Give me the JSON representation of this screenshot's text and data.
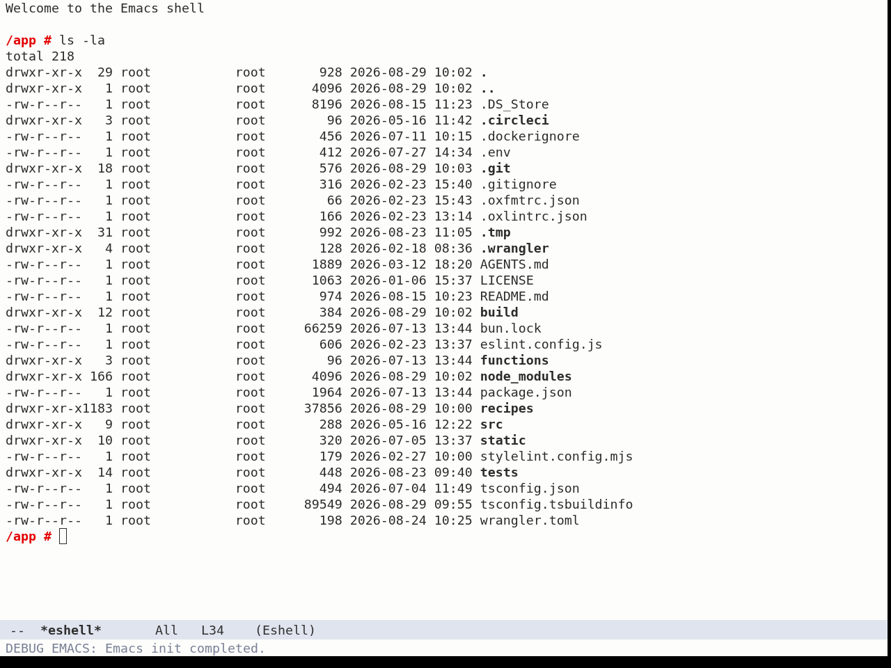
{
  "shell": {
    "banner": "Welcome to the Emacs shell",
    "command": {
      "prompt": "/app #",
      "input": "ls -la"
    },
    "total": "total 218",
    "entries": [
      {
        "kind": "directory",
        "permissions": "drwxr-xr-x",
        "links": "29",
        "owner": "root",
        "group": "root",
        "size": "928",
        "date": "2026-08-29",
        "time": "10:02",
        "name": "."
      },
      {
        "kind": "directory",
        "permissions": "drwxr-xr-x",
        "links": "1",
        "owner": "root",
        "group": "root",
        "size": "4096",
        "date": "2026-08-29",
        "time": "10:02",
        "name": ".."
      },
      {
        "kind": "file",
        "permissions": "-rw-r--r--",
        "links": "1",
        "owner": "root",
        "group": "root",
        "size": "8196",
        "date": "2026-08-15",
        "time": "11:23",
        "name": ".DS_Store"
      },
      {
        "kind": "directory",
        "permissions": "drwxr-xr-x",
        "links": "3",
        "owner": "root",
        "group": "root",
        "size": "96",
        "date": "2026-05-16",
        "time": "11:42",
        "name": ".circleci"
      },
      {
        "kind": "file",
        "permissions": "-rw-r--r--",
        "links": "1",
        "owner": "root",
        "group": "root",
        "size": "456",
        "date": "2026-07-11",
        "time": "10:15",
        "name": ".dockerignore"
      },
      {
        "kind": "file",
        "permissions": "-rw-r--r--",
        "links": "1",
        "owner": "root",
        "group": "root",
        "size": "412",
        "date": "2026-07-27",
        "time": "14:34",
        "name": ".env"
      },
      {
        "kind": "directory",
        "permissions": "drwxr-xr-x",
        "links": "18",
        "owner": "root",
        "group": "root",
        "size": "576",
        "date": "2026-08-29",
        "time": "10:03",
        "name": ".git"
      },
      {
        "kind": "file",
        "permissions": "-rw-r--r--",
        "links": "1",
        "owner": "root",
        "group": "root",
        "size": "316",
        "date": "2026-02-23",
        "time": "15:40",
        "name": ".gitignore"
      },
      {
        "kind": "file",
        "permissions": "-rw-r--r--",
        "links": "1",
        "owner": "root",
        "group": "root",
        "size": "66",
        "date": "2026-02-23",
        "time": "15:43",
        "name": ".oxfmtrc.json"
      },
      {
        "kind": "file",
        "permissions": "-rw-r--r--",
        "links": "1",
        "owner": "root",
        "group": "root",
        "size": "166",
        "date": "2026-02-23",
        "time": "13:14",
        "name": ".oxlintrc.json"
      },
      {
        "kind": "directory",
        "permissions": "drwxr-xr-x",
        "links": "31",
        "owner": "root",
        "group": "root",
        "size": "992",
        "date": "2026-08-23",
        "time": "11:05",
        "name": ".tmp"
      },
      {
        "kind": "directory",
        "permissions": "drwxr-xr-x",
        "links": "4",
        "owner": "root",
        "group": "root",
        "size": "128",
        "date": "2026-02-18",
        "time": "08:36",
        "name": ".wrangler"
      },
      {
        "kind": "file",
        "permissions": "-rw-r--r--",
        "links": "1",
        "owner": "root",
        "group": "root",
        "size": "1889",
        "date": "2026-03-12",
        "time": "18:20",
        "name": "AGENTS.md"
      },
      {
        "kind": "file",
        "permissions": "-rw-r--r--",
        "links": "1",
        "owner": "root",
        "group": "root",
        "size": "1063",
        "date": "2026-01-06",
        "time": "15:37",
        "name": "LICENSE"
      },
      {
        "kind": "file",
        "permissions": "-rw-r--r--",
        "links": "1",
        "owner": "root",
        "group": "root",
        "size": "974",
        "date": "2026-08-15",
        "time": "10:23",
        "name": "README.md"
      },
      {
        "kind": "directory",
        "permissions": "drwxr-xr-x",
        "links": "12",
        "owner": "root",
        "group": "root",
        "size": "384",
        "date": "2026-08-29",
        "time": "10:02",
        "name": "build"
      },
      {
        "kind": "file",
        "permissions": "-rw-r--r--",
        "links": "1",
        "owner": "root",
        "group": "root",
        "size": "66259",
        "date": "2026-07-13",
        "time": "13:44",
        "name": "bun.lock"
      },
      {
        "kind": "file",
        "permissions": "-rw-r--r--",
        "links": "1",
        "owner": "root",
        "group": "root",
        "size": "606",
        "date": "2026-02-23",
        "time": "13:37",
        "name": "eslint.config.js"
      },
      {
        "kind": "directory",
        "permissions": "drwxr-xr-x",
        "links": "3",
        "owner": "root",
        "group": "root",
        "size": "96",
        "date": "2026-07-13",
        "time": "13:44",
        "name": "functions"
      },
      {
        "kind": "directory",
        "permissions": "drwxr-xr-x",
        "links": "166",
        "owner": "root",
        "group": "root",
        "size": "4096",
        "date": "2026-08-29",
        "time": "10:02",
        "name": "node_modules"
      },
      {
        "kind": "file",
        "permissions": "-rw-r--r--",
        "links": "1",
        "owner": "root",
        "group": "root",
        "size": "1964",
        "date": "2026-07-13",
        "time": "13:44",
        "name": "package.json"
      },
      {
        "kind": "directory",
        "permissions": "drwxr-xr-x",
        "links": "1183",
        "owner": "root",
        "group": "root",
        "size": "37856",
        "date": "2026-08-29",
        "time": "10:00",
        "name": "recipes"
      },
      {
        "kind": "directory",
        "permissions": "drwxr-xr-x",
        "links": "9",
        "owner": "root",
        "group": "root",
        "size": "288",
        "date": "2026-05-16",
        "time": "12:22",
        "name": "src"
      },
      {
        "kind": "directory",
        "permissions": "drwxr-xr-x",
        "links": "10",
        "owner": "root",
        "group": "root",
        "size": "320",
        "date": "2026-07-05",
        "time": "13:37",
        "name": "static"
      },
      {
        "kind": "file",
        "permissions": "-rw-r--r--",
        "links": "1",
        "owner": "root",
        "group": "root",
        "size": "179",
        "date": "2026-02-27",
        "time": "10:00",
        "name": "stylelint.config.mjs"
      },
      {
        "kind": "directory",
        "permissions": "drwxr-xr-x",
        "links": "14",
        "owner": "root",
        "group": "root",
        "size": "448",
        "date": "2026-08-23",
        "time": "09:40",
        "name": "tests"
      },
      {
        "kind": "file",
        "permissions": "-rw-r--r--",
        "links": "1",
        "owner": "root",
        "group": "root",
        "size": "494",
        "date": "2026-07-04",
        "time": "11:49",
        "name": "tsconfig.json"
      },
      {
        "kind": "file",
        "permissions": "-rw-r--r--",
        "links": "1",
        "owner": "root",
        "group": "root",
        "size": "89549",
        "date": "2026-08-29",
        "time": "09:55",
        "name": "tsconfig.tsbuildinfo"
      },
      {
        "kind": "file",
        "permissions": "-rw-r--r--",
        "links": "1",
        "owner": "root",
        "group": "root",
        "size": "198",
        "date": "2026-08-24",
        "time": "10:25",
        "name": "wrangler.toml"
      }
    ],
    "current": {
      "prompt": "/app #",
      "cursor": true
    }
  },
  "mode_line": {
    "status": "--",
    "buffer_name": "*eshell*",
    "position": "All",
    "line": "L34",
    "major_mode": "(Eshell)"
  },
  "echo_area": {
    "message": "DEBUG EMACS: Emacs init completed."
  }
}
